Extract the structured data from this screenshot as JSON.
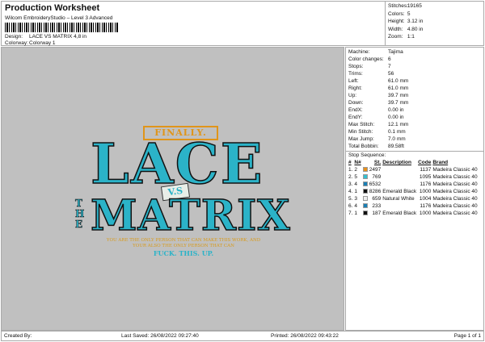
{
  "header": {
    "title": "Production Worksheet",
    "subtitle": "Wilcom EmbroideryStudio – Level 3 Advanced",
    "design_label": "Design:",
    "design_value": "LACE VS MATRIX 4,8 in",
    "colorway_label": "Colorway:",
    "colorway_value": "Colorway 1"
  },
  "stats": [
    {
      "k": "Stitches:",
      "v": "19165"
    },
    {
      "k": "Colors:",
      "v": "5"
    },
    {
      "k": "Height:",
      "v": "3.12 in"
    },
    {
      "k": "Width:",
      "v": "4.80 in"
    },
    {
      "k": "Zoom:",
      "v": "1:1"
    }
  ],
  "machine": [
    {
      "k": "Machine:",
      "v": "Tajima"
    },
    {
      "k": "Color changes:",
      "v": "6"
    },
    {
      "k": "Stops:",
      "v": "7"
    },
    {
      "k": "Trims:",
      "v": "56"
    },
    {
      "k": "Left:",
      "v": "61.0 mm"
    },
    {
      "k": "Right:",
      "v": "61.0 mm"
    },
    {
      "k": "Up:",
      "v": "39.7 mm"
    },
    {
      "k": "Down:",
      "v": "39.7 mm"
    },
    {
      "k": "EndX:",
      "v": "0.00 in"
    },
    {
      "k": "EndY:",
      "v": "0.00 in"
    },
    {
      "k": "Max Stitch:",
      "v": "12.1 mm"
    },
    {
      "k": "Min Stitch:",
      "v": "0.1 mm"
    },
    {
      "k": "Max Jump:",
      "v": "7.0 mm"
    },
    {
      "k": "Total Bobbin:",
      "v": "89.58ft"
    }
  ],
  "stop_sequence": {
    "label": "Stop Sequence:",
    "headers": [
      "#",
      "N#",
      "St.",
      "Description",
      "Code",
      "Brand"
    ],
    "rows": [
      {
        "i": "1.",
        "n": "2",
        "color": "#e8901a",
        "st": "2497",
        "desc": "",
        "code": "1137",
        "brand": "Madeira Classic 40"
      },
      {
        "i": "2.",
        "n": "5",
        "color": "#35c0d0",
        "st": "769",
        "desc": "",
        "code": "1095",
        "brand": "Madeira Classic 40"
      },
      {
        "i": "3.",
        "n": "4",
        "color": "#1a7fb5",
        "st": "6532",
        "desc": "",
        "code": "1176",
        "brand": "Madeira Classic 40"
      },
      {
        "i": "4.",
        "n": "1",
        "color": "#111111",
        "st": "8286",
        "desc": "Emerald Black",
        "code": "1000",
        "brand": "Madeira Classic 40"
      },
      {
        "i": "5.",
        "n": "3",
        "color": "#eeeeee",
        "st": "659",
        "desc": "Natural White",
        "code": "1004",
        "brand": "Madeira Classic 40"
      },
      {
        "i": "6.",
        "n": "4",
        "color": "#1a7fb5",
        "st": "233",
        "desc": "",
        "code": "1176",
        "brand": "Madeira Classic 40"
      },
      {
        "i": "7.",
        "n": "1",
        "color": "#111111",
        "st": "187",
        "desc": "Emerald Black",
        "code": "1000",
        "brand": "Madeira Classic 40"
      }
    ]
  },
  "design_artwork": {
    "finally": "FINALLY.",
    "lace": "LACE",
    "vs": "V.S",
    "the": "THE",
    "matrix": "MATRIX",
    "line1": "YOU ARE THE ONLY PERSON THAT CAN MAKE THIS WORK, AND",
    "line2": "YOUR ALSO THE ONLY PERSON THAT CAN",
    "line3": "FUCK. THIS. UP."
  },
  "footer": {
    "created": "Created By:",
    "saved": "Last Saved: 26/08/2022 09:27:40",
    "printed": "Printed: 26/08/2022 09:43:22",
    "page": "Page 1 of 1"
  }
}
